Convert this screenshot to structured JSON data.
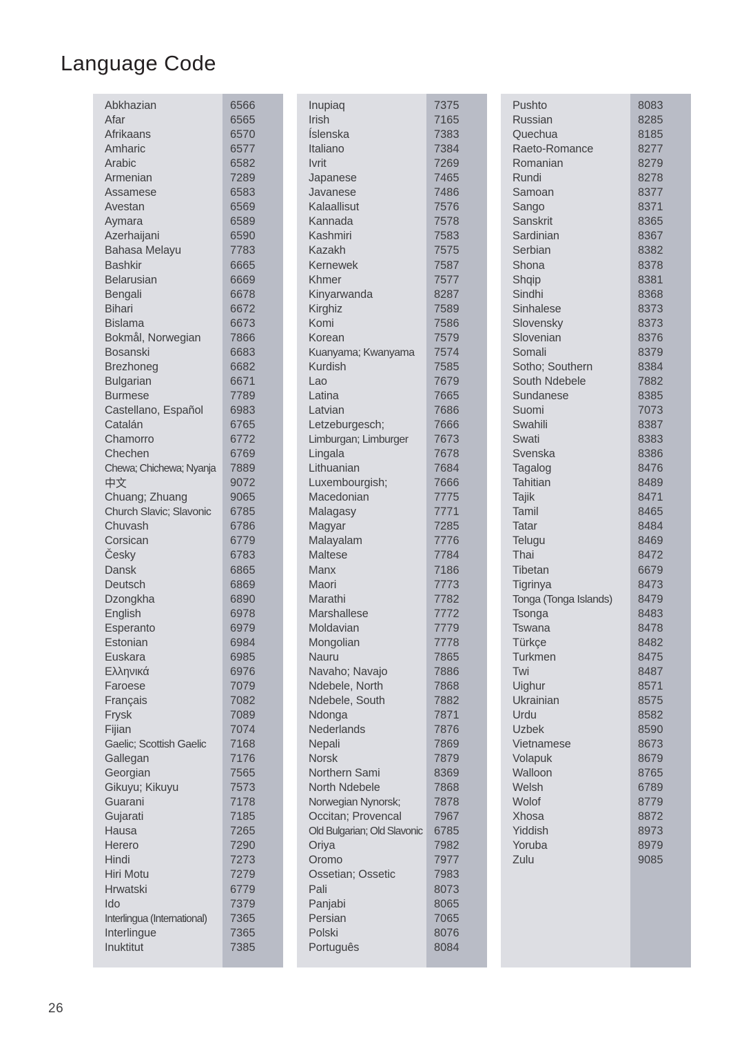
{
  "page": {
    "title": "Language Code",
    "page_number": "26"
  },
  "colors": {
    "name_cell_bg": "#dddee3",
    "code_cell_bg": "#b9bcc6",
    "text": "#3a3a3c",
    "title_text": "#231f20",
    "page_bg": "#ffffff"
  },
  "columns": [
    {
      "id": "column-1",
      "rows": [
        {
          "language": "Abkhazian",
          "code": "6566"
        },
        {
          "language": "Afar",
          "code": "6565"
        },
        {
          "language": "Afrikaans",
          "code": "6570"
        },
        {
          "language": "Amharic",
          "code": "6577"
        },
        {
          "language": "Arabic",
          "code": "6582"
        },
        {
          "language": "Armenian",
          "code": "7289"
        },
        {
          "language": "Assamese",
          "code": "6583"
        },
        {
          "language": "Avestan",
          "code": "6569"
        },
        {
          "language": "Aymara",
          "code": "6589"
        },
        {
          "language": "Azerhaijani",
          "code": "6590"
        },
        {
          "language": "Bahasa Melayu",
          "code": "7783"
        },
        {
          "language": "Bashkir",
          "code": "6665"
        },
        {
          "language": "Belarusian",
          "code": "6669"
        },
        {
          "language": "Bengali",
          "code": "6678"
        },
        {
          "language": "Bihari",
          "code": "6672"
        },
        {
          "language": "Bislama",
          "code": "6673"
        },
        {
          "language": "Bokmål, Norwegian",
          "code": "7866"
        },
        {
          "language": "Bosanski",
          "code": "6683"
        },
        {
          "language": "Brezhoneg",
          "code": "6682"
        },
        {
          "language": "Bulgarian",
          "code": "6671"
        },
        {
          "language": "Burmese",
          "code": "7789"
        },
        {
          "language": "Castellano, Español",
          "code": "6983"
        },
        {
          "language": "Catalán",
          "code": "6765"
        },
        {
          "language": "Chamorro",
          "code": "6772"
        },
        {
          "language": "Chechen",
          "code": "6769"
        },
        {
          "language": "Chewa; Chichewa; Nyanja",
          "code": "7889",
          "fit": "xtight"
        },
        {
          "language": "中文",
          "code": "9072",
          "script": "cjk"
        },
        {
          "language": "Chuang; Zhuang",
          "code": "9065"
        },
        {
          "language": "Church Slavic; Slavonic",
          "code": "6785",
          "fit": "tight"
        },
        {
          "language": "Chuvash",
          "code": "6786"
        },
        {
          "language": "Corsican",
          "code": "6779"
        },
        {
          "language": "Česky",
          "code": "6783"
        },
        {
          "language": "Dansk",
          "code": "6865"
        },
        {
          "language": "Deutsch",
          "code": "6869"
        },
        {
          "language": "Dzongkha",
          "code": "6890"
        },
        {
          "language": "English",
          "code": "6978"
        },
        {
          "language": "Esperanto",
          "code": "6979"
        },
        {
          "language": "Estonian",
          "code": "6984"
        },
        {
          "language": "Euskara",
          "code": "6985"
        },
        {
          "language": "Ελληνικά",
          "code": "6976"
        },
        {
          "language": "Faroese",
          "code": "7079"
        },
        {
          "language": "Français",
          "code": "7082"
        },
        {
          "language": "Frysk",
          "code": "7089"
        },
        {
          "language": "Fijian",
          "code": "7074"
        },
        {
          "language": "Gaelic; Scottish Gaelic",
          "code": "7168",
          "fit": "tight"
        },
        {
          "language": "Gallegan",
          "code": "7176"
        },
        {
          "language": "Georgian",
          "code": "7565"
        },
        {
          "language": "Gikuyu; Kikuyu",
          "code": "7573"
        },
        {
          "language": "Guarani",
          "code": "7178"
        },
        {
          "language": "Gujarati",
          "code": "7185"
        },
        {
          "language": "Hausa",
          "code": "7265"
        },
        {
          "language": "Herero",
          "code": "7290"
        },
        {
          "language": "Hindi",
          "code": "7273"
        },
        {
          "language": "Hiri Motu",
          "code": "7279"
        },
        {
          "language": "Hrwatski",
          "code": "6779"
        },
        {
          "language": "Ido",
          "code": "7379"
        },
        {
          "language": "Interlingua (International)",
          "code": "7365",
          "fit": "xtight"
        },
        {
          "language": "Interlingue",
          "code": "7365"
        },
        {
          "language": "Inuktitut",
          "code": "7385"
        }
      ]
    },
    {
      "id": "column-2",
      "rows": [
        {
          "language": "Inupiaq",
          "code": "7375"
        },
        {
          "language": "Irish",
          "code": "7165"
        },
        {
          "language": "Íslenska",
          "code": "7383"
        },
        {
          "language": "Italiano",
          "code": "7384"
        },
        {
          "language": "Ivrit",
          "code": "7269"
        },
        {
          "language": "Japanese",
          "code": "7465"
        },
        {
          "language": "Javanese",
          "code": "7486"
        },
        {
          "language": "Kalaallisut",
          "code": "7576"
        },
        {
          "language": "Kannada",
          "code": "7578"
        },
        {
          "language": "Kashmiri",
          "code": "7583"
        },
        {
          "language": "Kazakh",
          "code": "7575"
        },
        {
          "language": "Kernewek",
          "code": "7587"
        },
        {
          "language": "Khmer",
          "code": "7577"
        },
        {
          "language": "Kinyarwanda",
          "code": "8287"
        },
        {
          "language": "Kirghiz",
          "code": "7589"
        },
        {
          "language": "Komi",
          "code": "7586"
        },
        {
          "language": "Korean",
          "code": "7579"
        },
        {
          "language": "Kuanyama; Kwanyama",
          "code": "7574",
          "fit": "tight"
        },
        {
          "language": "Kurdish",
          "code": "7585"
        },
        {
          "language": "Lao",
          "code": "7679"
        },
        {
          "language": "Latina",
          "code": "7665"
        },
        {
          "language": "Latvian",
          "code": "7686"
        },
        {
          "language": "Letzeburgesch;",
          "code": "7666"
        },
        {
          "language": "Limburgan; Limburger",
          "code": "7673",
          "fit": "tight"
        },
        {
          "language": "Lingala",
          "code": "7678"
        },
        {
          "language": "Lithuanian",
          "code": "7684"
        },
        {
          "language": "Luxembourgish;",
          "code": "7666"
        },
        {
          "language": "Macedonian",
          "code": "7775"
        },
        {
          "language": "Malagasy",
          "code": "7771"
        },
        {
          "language": "Magyar",
          "code": "7285"
        },
        {
          "language": "Malayalam",
          "code": "7776"
        },
        {
          "language": "Maltese",
          "code": "7784"
        },
        {
          "language": "Manx",
          "code": "7186"
        },
        {
          "language": "Maori",
          "code": "7773"
        },
        {
          "language": "Marathi",
          "code": "7782"
        },
        {
          "language": "Marshallese",
          "code": "7772"
        },
        {
          "language": "Moldavian",
          "code": "7779"
        },
        {
          "language": "Mongolian",
          "code": "7778"
        },
        {
          "language": "Nauru",
          "code": "7865"
        },
        {
          "language": "Navaho; Navajo",
          "code": "7886"
        },
        {
          "language": "Ndebele, North",
          "code": "7868"
        },
        {
          "language": "Ndebele, South",
          "code": "7882"
        },
        {
          "language": "Ndonga",
          "code": "7871"
        },
        {
          "language": "Nederlands",
          "code": "7876"
        },
        {
          "language": "Nepali",
          "code": "7869"
        },
        {
          "language": "Norsk",
          "code": "7879"
        },
        {
          "language": "Northern Sami",
          "code": "8369"
        },
        {
          "language": "North Ndebele",
          "code": "7868"
        },
        {
          "language": "Norwegian Nynorsk;",
          "code": "7878",
          "fit": "tight"
        },
        {
          "language": "Occitan; Provencal",
          "code": "7967"
        },
        {
          "language": "Old Bulgarian; Old Slavonic",
          "code": "6785",
          "fit": "xtight"
        },
        {
          "language": "Oriya",
          "code": "7982"
        },
        {
          "language": "Oromo",
          "code": "7977"
        },
        {
          "language": "Ossetian; Ossetic",
          "code": "7983"
        },
        {
          "language": "Pali",
          "code": "8073"
        },
        {
          "language": "Panjabi",
          "code": "8065"
        },
        {
          "language": "Persian",
          "code": "7065"
        },
        {
          "language": "Polski",
          "code": "8076"
        },
        {
          "language": "Português",
          "code": "8084"
        }
      ]
    },
    {
      "id": "column-3",
      "rows": [
        {
          "language": "Pushto",
          "code": "8083"
        },
        {
          "language": "Russian",
          "code": "8285"
        },
        {
          "language": "Quechua",
          "code": "8185"
        },
        {
          "language": "Raeto-Romance",
          "code": "8277"
        },
        {
          "language": "Romanian",
          "code": "8279"
        },
        {
          "language": "Rundi",
          "code": "8278"
        },
        {
          "language": "Samoan",
          "code": "8377"
        },
        {
          "language": "Sango",
          "code": "8371"
        },
        {
          "language": "Sanskrit",
          "code": "8365"
        },
        {
          "language": "Sardinian",
          "code": "8367"
        },
        {
          "language": "Serbian",
          "code": "8382"
        },
        {
          "language": "Shona",
          "code": "8378"
        },
        {
          "language": "Shqip",
          "code": "8381"
        },
        {
          "language": "Sindhi",
          "code": "8368"
        },
        {
          "language": "Sinhalese",
          "code": "8373"
        },
        {
          "language": "Slovensky",
          "code": "8373"
        },
        {
          "language": "Slovenian",
          "code": "8376"
        },
        {
          "language": "Somali",
          "code": "8379"
        },
        {
          "language": "Sotho; Southern",
          "code": "8384"
        },
        {
          "language": "South Ndebele",
          "code": "7882"
        },
        {
          "language": "Sundanese",
          "code": "8385"
        },
        {
          "language": "Suomi",
          "code": "7073"
        },
        {
          "language": "Swahili",
          "code": "8387"
        },
        {
          "language": "Swati",
          "code": "8383"
        },
        {
          "language": "Svenska",
          "code": "8386"
        },
        {
          "language": "Tagalog",
          "code": "8476"
        },
        {
          "language": "Tahitian",
          "code": "8489"
        },
        {
          "language": "Tajik",
          "code": "8471"
        },
        {
          "language": "Tamil",
          "code": "8465"
        },
        {
          "language": "Tatar",
          "code": "8484"
        },
        {
          "language": "Telugu",
          "code": "8469"
        },
        {
          "language": "Thai",
          "code": "8472"
        },
        {
          "language": "Tibetan",
          "code": "6679"
        },
        {
          "language": "Tigrinya",
          "code": "8473"
        },
        {
          "language": "Tonga (Tonga Islands)",
          "code": "8479",
          "fit": "tight"
        },
        {
          "language": "Tsonga",
          "code": "8483"
        },
        {
          "language": "Tswana",
          "code": "8478"
        },
        {
          "language": "Türkçe",
          "code": "8482"
        },
        {
          "language": "Turkmen",
          "code": "8475"
        },
        {
          "language": "Twi",
          "code": "8487"
        },
        {
          "language": "Uighur",
          "code": "8571"
        },
        {
          "language": "Ukrainian",
          "code": "8575"
        },
        {
          "language": "Urdu",
          "code": "8582"
        },
        {
          "language": "Uzbek",
          "code": "8590"
        },
        {
          "language": "Vietnamese",
          "code": "8673"
        },
        {
          "language": "Volapuk",
          "code": "8679"
        },
        {
          "language": "Walloon",
          "code": "8765"
        },
        {
          "language": "Welsh",
          "code": "6789"
        },
        {
          "language": "Wolof",
          "code": "8779"
        },
        {
          "language": "Xhosa",
          "code": "8872"
        },
        {
          "language": "Yiddish",
          "code": "8973"
        },
        {
          "language": "Yoruba",
          "code": "8979"
        },
        {
          "language": "Zulu",
          "code": "9085"
        }
      ]
    }
  ]
}
